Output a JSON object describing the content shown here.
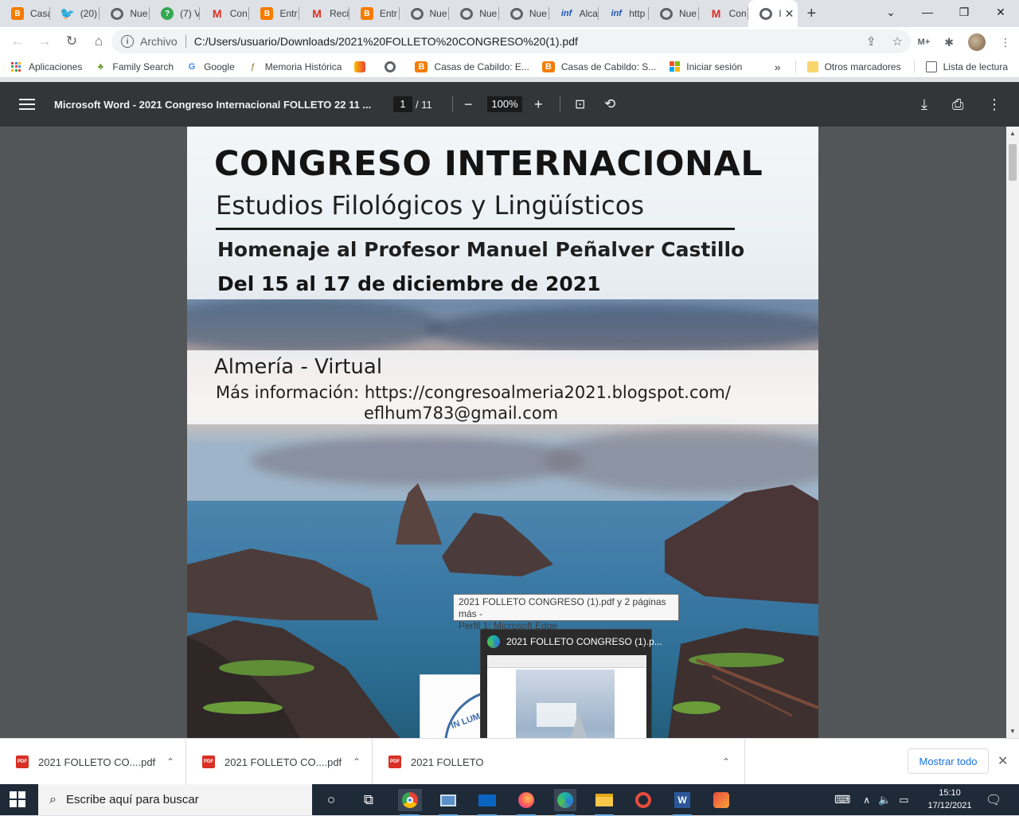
{
  "tabs": [
    {
      "label": "Casa",
      "icon": "blogger-icon"
    },
    {
      "label": "(20)",
      "icon": "twitter-icon"
    },
    {
      "label": "Nue",
      "icon": "chrome-icon"
    },
    {
      "label": "(7) V",
      "icon": "whatsapp-icon"
    },
    {
      "label": "Con",
      "icon": "gmail-icon"
    },
    {
      "label": "Entr",
      "icon": "blogger-icon"
    },
    {
      "label": "Reci",
      "icon": "gmail-icon"
    },
    {
      "label": "Entr",
      "icon": "blogger-icon"
    },
    {
      "label": "Nue",
      "icon": "chrome-icon"
    },
    {
      "label": "Nue",
      "icon": "chrome-icon"
    },
    {
      "label": "Nue",
      "icon": "chrome-icon"
    },
    {
      "label": "Alca",
      "icon": "inf-icon"
    },
    {
      "label": "http",
      "icon": "inf-icon"
    },
    {
      "label": "Nue",
      "icon": "chrome-icon"
    },
    {
      "label": "Con",
      "icon": "gmail-icon"
    },
    {
      "label": "I",
      "icon": "globe-icon",
      "active": true
    }
  ],
  "toolbar": {
    "origin_label": "Archivo",
    "url": "C:/Users/usuario/Downloads/2021%20FOLLETO%20CONGRESO%20(1).pdf"
  },
  "bookmarks": {
    "items": [
      {
        "label": "Aplicaciones"
      },
      {
        "label": "Family Search"
      },
      {
        "label": "Google"
      },
      {
        "label": "Memoria Histórica"
      },
      {
        "label": ""
      },
      {
        "label": ""
      },
      {
        "label": "Casas de Cabildo: E..."
      },
      {
        "label": "Casas de Cabildo: S..."
      },
      {
        "label": "Iniciar sesión"
      }
    ],
    "overflow": "»",
    "other": "Otros marcadores",
    "reading_list": "Lista de lectura"
  },
  "pdf": {
    "title": "Microsoft Word - 2021 Congreso Internacional FOLLETO 22 11 ...",
    "page_current": "1",
    "page_total": "/ 11",
    "zoom": "100%"
  },
  "brochure": {
    "title": "CONGRESO INTERNACIONAL",
    "subtitle": "Estudios Filológicos y Lingüísticos",
    "homage": "Homenaje al  Profesor Manuel Peñalver Castillo",
    "dates": "Del 15 al 17 de diciembre de 2021",
    "place": "Almería - Virtual",
    "info": "Más información: https://congresoalmeria2021.blogspot.com/",
    "email": "eflhum783@gmail.com",
    "seal_text": "IN LUM"
  },
  "tooltip": {
    "line1": "2021 FOLLETO CONGRESO (1).pdf y 2 páginas más -",
    "line2": "Perfil 1: Microsoft Edge"
  },
  "thumbnail": {
    "title": "2021 FOLLETO CONGRESO (1).p..."
  },
  "downloads": {
    "items": [
      {
        "name": "2021 FOLLETO CO....pdf"
      },
      {
        "name": "2021 FOLLETO CO....pdf"
      },
      {
        "name": "2021 FOLLETO"
      }
    ],
    "show_all": "Mostrar todo"
  },
  "taskbar": {
    "search_placeholder": "Escribe aquí para buscar",
    "time": "15:10",
    "date": "17/12/2021"
  },
  "colors": {
    "pdf_toolbar": "#323639",
    "pdf_background": "#525659",
    "taskbar": "#1f2a38",
    "link_blue": "#1a73e8"
  }
}
